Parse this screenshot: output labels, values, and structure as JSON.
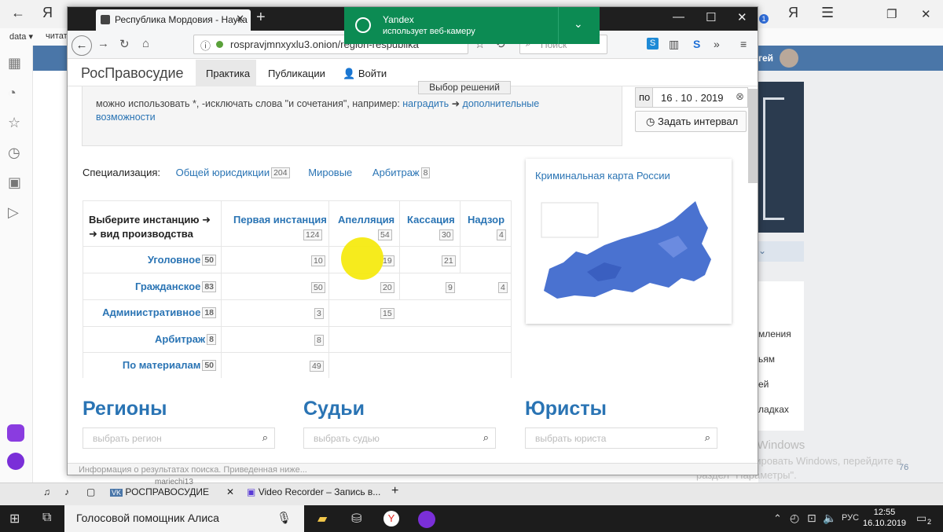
{
  "yandex": {
    "back": "←",
    "logo": "Я",
    "bookmarks": [
      "data ▾",
      "читат"
    ],
    "right_icons": [
      "Я",
      "☰",
      "❐",
      "✕"
    ],
    "badge": "1"
  },
  "sidebar_icons": [
    "grid-icon",
    "bell-icon",
    "star-icon",
    "clock-icon",
    "collections-icon",
    "play-icon"
  ],
  "vk": {
    "user": "гей",
    "more_btn": "⌄",
    "menu": [
      "мления",
      "ьям",
      "ей",
      "ладках"
    ],
    "count": "76"
  },
  "activation": {
    "title": "Активация Windows",
    "line1": "Чтобы активировать Windows, перейдите в",
    "line2": "раздел \"Параметры\"."
  },
  "notification": {
    "title": "Yandex",
    "text": "использует веб-камеру"
  },
  "tab": {
    "title": "Республика Мордовия - Наука",
    "close": "✕",
    "new": "+"
  },
  "window_controls": {
    "min": "—",
    "max": "☐",
    "close": "✕"
  },
  "nav": {
    "url": "rospravjmnxyxlu3.onion/region-respublika",
    "search_placeholder": "Поиск"
  },
  "site": {
    "logo": "РосПравосудие",
    "menu": [
      "Практика",
      "Публикации",
      "Войти"
    ],
    "select_btn": "Выбор решений",
    "hint_pre": "можно использовать *, -исключать слова \"и сочетания\", например: ",
    "hint_link1": "наградить",
    "hint_arrow": " ➜ ",
    "hint_link2": "дополнительные возможности",
    "date_po": "по",
    "date_value": "16 . 10 . 2019",
    "interval_btn": "Задать интервал",
    "spec_label": "Специализация:",
    "spec": [
      {
        "name": "Общей юрисдикции",
        "count": "204"
      },
      {
        "name": "Мировые",
        "count": ""
      },
      {
        "name": "Арбитраж",
        "count": "8"
      }
    ],
    "table": {
      "corner": [
        "Выберите инстанцию ➜",
        "➜ вид производства"
      ],
      "columns": [
        {
          "name": "Первая инстанция",
          "count": "124"
        },
        {
          "name": "Апелляция",
          "count": "54"
        },
        {
          "name": "Кассация",
          "count": "30"
        },
        {
          "name": "Надзор",
          "count": "4"
        }
      ],
      "rows": [
        {
          "name": "Уголовное",
          "count": "50",
          "cells": [
            "10",
            "19",
            "21",
            ""
          ]
        },
        {
          "name": "Гражданское",
          "count": "83",
          "cells": [
            "50",
            "20",
            "9",
            "4"
          ]
        },
        {
          "name": "Административное",
          "count": "18",
          "cells": [
            "3",
            "15",
            "",
            ""
          ]
        },
        {
          "name": "Арбитраж",
          "count": "8",
          "cells": [
            "8",
            "",
            "",
            ""
          ]
        },
        {
          "name": "По материалам",
          "count": "50",
          "cells": [
            "49",
            "",
            "",
            ""
          ]
        }
      ]
    },
    "map_title": "Криминальная карта России",
    "sections": [
      {
        "title": "Регионы",
        "placeholder": "выбрать регион"
      },
      {
        "title": "Судьи",
        "placeholder": "выбрать судью"
      },
      {
        "title": "Юристы",
        "placeholder": "выбрать юриста"
      }
    ],
    "footer": "Информация о результатах поиска. Приведенная ниже..."
  },
  "ytabs": [
    {
      "label": "РОСПРАВОСУДИЕ",
      "close": "✕"
    },
    {
      "label": "Video Recorder – Запись в..."
    }
  ],
  "ytabs_under": "mariechi13",
  "ytabs_new": "+",
  "taskbar": {
    "alice": "Голосовой помощник Алиса",
    "lang": "РУС",
    "time": "12:55",
    "date": "16.10.2019",
    "notif": "2"
  }
}
